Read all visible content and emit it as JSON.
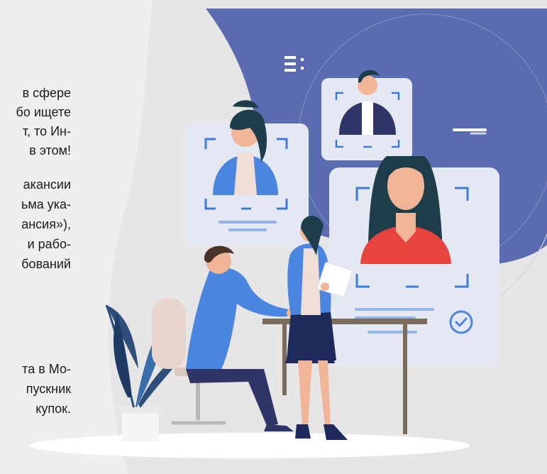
{
  "text_lines": [
    "в сфере",
    "бо ищете",
    "т, то Ин-",
    "в этом!",
    "акансии",
    "ьма ука-",
    "ансия»),",
    "и рабо-",
    "бований",
    "та в Мо-",
    "пускник",
    "купок."
  ],
  "colors": {
    "page_background": "#efefef",
    "blob_background": "#e6e6e6",
    "accent_blue": "#5b6bb0",
    "card_background": "#e4e8f3",
    "card_frame_blue": "#3d7bd6",
    "card_line_blue": "#8fb3ea",
    "check_circle_blue": "#4a86e0",
    "woman_top_red": "#e8443f",
    "jacket_blue": "#4a86e0"
  },
  "icons": {
    "menu": "menu-icon",
    "check": "check-circle-icon"
  }
}
